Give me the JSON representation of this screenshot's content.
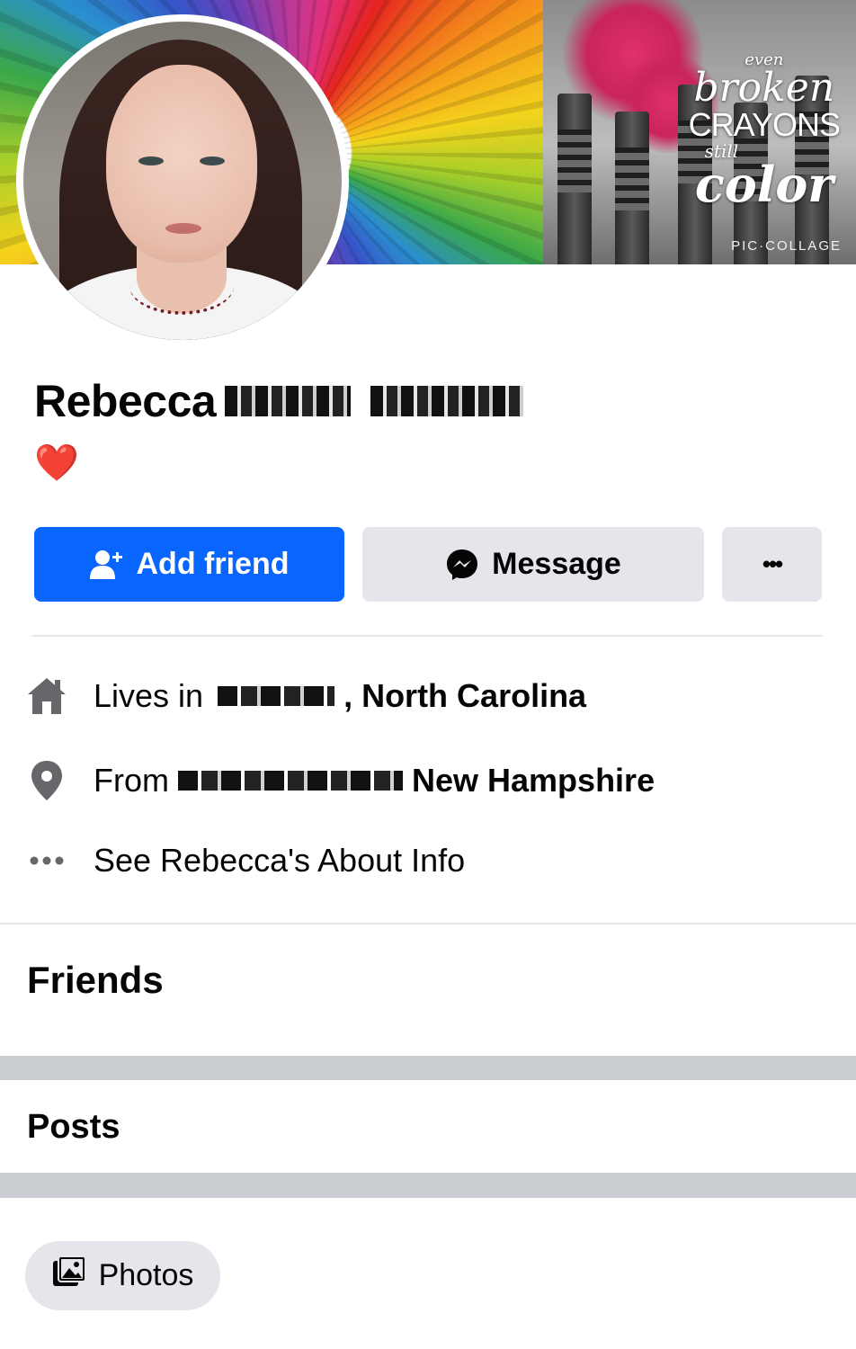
{
  "cover": {
    "text_even": "even",
    "text_broken": "broken",
    "text_crayons": "CRAYONS",
    "text_still": "still",
    "text_color": "color",
    "credit": "PIC·COLLAGE"
  },
  "profile": {
    "first_name": "Rebecca",
    "bio_emoji": "❤️"
  },
  "actions": {
    "add_friend_label": "Add friend",
    "message_label": "Message",
    "more_label": "•••"
  },
  "intro": {
    "lives_in_prefix": "Lives in",
    "lives_in_suffix": ", North Carolina",
    "from_prefix": "From",
    "from_suffix": "New Hampshire",
    "about_link": "See Rebecca's About Info"
  },
  "sections": {
    "friends_title": "Friends",
    "posts_title": "Posts"
  },
  "filters": {
    "photos_label": "Photos"
  },
  "icons": {
    "add_friend": "person-add-icon",
    "message": "messenger-icon",
    "more": "more-horizontal-icon",
    "home": "home-icon",
    "location": "location-pin-icon",
    "about": "more-horizontal-icon",
    "photos": "photos-icon"
  },
  "colors": {
    "primary_blue": "#0866ff",
    "button_gray": "#e4e6eb",
    "band_gray": "#c9ccd1",
    "text": "#050505",
    "icon_gray": "#65676b"
  }
}
